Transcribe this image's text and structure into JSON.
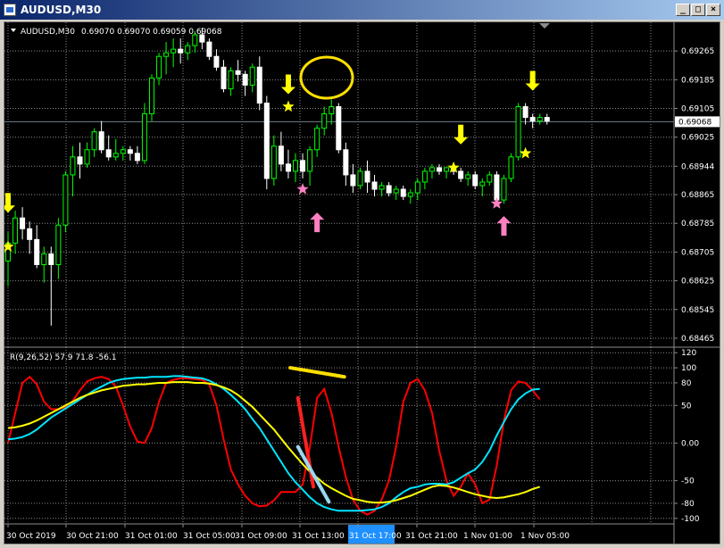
{
  "window": {
    "title": "AUDUSD,M30",
    "buttons": [
      "_",
      "□",
      "×"
    ]
  },
  "chart_header": {
    "symbol": "AUDUSD,M30",
    "ohlc": "0.69070 0.69070 0.69059 0.69068"
  },
  "indicator_label": "R(9,26,52) 57.9 71.8 -56.1",
  "current_price": "0.69068",
  "colors": {
    "bull_candle": "#00ff00",
    "bear_candle": "#ffffff",
    "grid": "#8c8c8c",
    "fast_line": "#ff0000",
    "medium_line": "#00e5ff",
    "slow_line": "#ffff00",
    "sell_arrow": "#ffff00",
    "buy_arrow": "#ff80c0",
    "annotation_yellow": "#ffe000",
    "time_highlight": "#1e90ff"
  },
  "chart_data": [
    {
      "type": "candlestick",
      "title": "AUDUSD,M30",
      "ylim": [
        0.68445,
        0.69335
      ],
      "y_ticks": [
        "0.69265",
        "0.69185",
        "0.69105",
        "0.69025",
        "0.68944",
        "0.68865",
        "0.68785",
        "0.68705",
        "0.68625",
        "0.68545",
        "0.68465"
      ],
      "y_tick_values": [
        0.69265,
        0.69185,
        0.69105,
        0.69025,
        0.68944,
        0.68865,
        0.68785,
        0.68705,
        0.68625,
        0.68545,
        0.68465
      ],
      "x_ticks": [
        "30 Oct 2019",
        "30 Oct 21:00",
        "31 Oct 01:00",
        "31 Oct 05:00",
        "31 Oct 09:00",
        "31 Oct 13:00",
        "31 Oct 17:00",
        "31 Oct 21:00",
        "1 Nov 01:00",
        "1 Nov 05:00"
      ],
      "candles": [
        [
          0.6868,
          0.6876,
          0.6861,
          0.6873
        ],
        [
          0.6873,
          0.6882,
          0.687,
          0.688
        ],
        [
          0.688,
          0.6883,
          0.6874,
          0.6877
        ],
        [
          0.6877,
          0.6879,
          0.687,
          0.6874
        ],
        [
          0.6874,
          0.6878,
          0.6866,
          0.6867
        ],
        [
          0.6867,
          0.6872,
          0.6862,
          0.687
        ],
        [
          0.687,
          0.6872,
          0.685,
          0.6867
        ],
        [
          0.6867,
          0.688,
          0.6863,
          0.6878
        ],
        [
          0.6878,
          0.6893,
          0.6876,
          0.6892
        ],
        [
          0.6892,
          0.69,
          0.6886,
          0.6897
        ],
        [
          0.6897,
          0.6901,
          0.6891,
          0.6895
        ],
        [
          0.6895,
          0.6901,
          0.6894,
          0.6899
        ],
        [
          0.6899,
          0.6905,
          0.6897,
          0.6904
        ],
        [
          0.6904,
          0.6907,
          0.6898,
          0.6899
        ],
        [
          0.6899,
          0.6903,
          0.6896,
          0.6897
        ],
        [
          0.6897,
          0.6902,
          0.6896,
          0.6898
        ],
        [
          0.6898,
          0.69,
          0.6896,
          0.6899
        ],
        [
          0.6899,
          0.69,
          0.6896,
          0.6898
        ],
        [
          0.6898,
          0.69,
          0.6895,
          0.6896
        ],
        [
          0.6896,
          0.6912,
          0.6895,
          0.6909
        ],
        [
          0.6909,
          0.692,
          0.6907,
          0.6919
        ],
        [
          0.6919,
          0.6926,
          0.6917,
          0.6925
        ],
        [
          0.6925,
          0.6929,
          0.692,
          0.6926
        ],
        [
          0.6926,
          0.693,
          0.6922,
          0.6927
        ],
        [
          0.6927,
          0.693,
          0.6923,
          0.6926
        ],
        [
          0.6926,
          0.6929,
          0.6924,
          0.6928
        ],
        [
          0.6928,
          0.6932,
          0.6926,
          0.6931
        ],
        [
          0.6931,
          0.6933,
          0.6927,
          0.6929
        ],
        [
          0.6929,
          0.693,
          0.6924,
          0.6925
        ],
        [
          0.6925,
          0.6927,
          0.6921,
          0.6922
        ],
        [
          0.6922,
          0.6924,
          0.6915,
          0.6916
        ],
        [
          0.6916,
          0.6922,
          0.6914,
          0.6921
        ],
        [
          0.6921,
          0.6924,
          0.6918,
          0.692
        ],
        [
          0.692,
          0.6921,
          0.6914,
          0.6917
        ],
        [
          0.6917,
          0.6923,
          0.6915,
          0.6922
        ],
        [
          0.6922,
          0.6925,
          0.691,
          0.6912
        ],
        [
          0.6912,
          0.6914,
          0.6888,
          0.6891
        ],
        [
          0.6891,
          0.6903,
          0.6889,
          0.69
        ],
        [
          0.69,
          0.6904,
          0.6893,
          0.6895
        ],
        [
          0.6895,
          0.6899,
          0.6891,
          0.6893
        ],
        [
          0.6893,
          0.6898,
          0.689,
          0.6896
        ],
        [
          0.6896,
          0.6898,
          0.6891,
          0.6893
        ],
        [
          0.6893,
          0.69,
          0.6889,
          0.6899
        ],
        [
          0.6899,
          0.6906,
          0.6897,
          0.6905
        ],
        [
          0.6905,
          0.6911,
          0.6903,
          0.6909
        ],
        [
          0.6909,
          0.6913,
          0.6906,
          0.6911
        ],
        [
          0.6911,
          0.6912,
          0.6898,
          0.6899
        ],
        [
          0.6899,
          0.6901,
          0.6889,
          0.6892
        ],
        [
          0.6892,
          0.6895,
          0.6887,
          0.6889
        ],
        [
          0.6889,
          0.6894,
          0.6888,
          0.6893
        ],
        [
          0.6893,
          0.6896,
          0.6887,
          0.689
        ],
        [
          0.689,
          0.6892,
          0.6886,
          0.6888
        ],
        [
          0.6888,
          0.689,
          0.6886,
          0.6889
        ],
        [
          0.6889,
          0.689,
          0.6886,
          0.6887
        ],
        [
          0.6887,
          0.6889,
          0.6885,
          0.6888
        ],
        [
          0.6888,
          0.6889,
          0.6885,
          0.6886
        ],
        [
          0.6886,
          0.6888,
          0.6884,
          0.6887
        ],
        [
          0.6887,
          0.6891,
          0.6885,
          0.689
        ],
        [
          0.689,
          0.6894,
          0.6888,
          0.6893
        ],
        [
          0.6893,
          0.6895,
          0.6891,
          0.6894
        ],
        [
          0.6894,
          0.6895,
          0.6892,
          0.6893
        ],
        [
          0.6893,
          0.6894,
          0.6891,
          0.6894
        ],
        [
          0.6894,
          0.6895,
          0.6892,
          0.6893
        ],
        [
          0.6893,
          0.6894,
          0.689,
          0.6891
        ],
        [
          0.6891,
          0.6893,
          0.6889,
          0.6892
        ],
        [
          0.6892,
          0.6893,
          0.6888,
          0.6889
        ],
        [
          0.6889,
          0.6891,
          0.6886,
          0.689
        ],
        [
          0.689,
          0.6893,
          0.6889,
          0.6892
        ],
        [
          0.6892,
          0.6893,
          0.6884,
          0.6885
        ],
        [
          0.6885,
          0.6892,
          0.6884,
          0.6891
        ],
        [
          0.6891,
          0.6898,
          0.689,
          0.6897
        ],
        [
          0.6897,
          0.6912,
          0.6896,
          0.6911
        ],
        [
          0.6911,
          0.6912,
          0.6906,
          0.6908
        ],
        [
          0.6908,
          0.6909,
          0.6905,
          0.6907
        ],
        [
          0.6907,
          0.6909,
          0.6906,
          0.6908
        ],
        [
          0.6908,
          0.6909,
          0.6906,
          0.6907
        ]
      ],
      "current_price": 0.69068,
      "signals": [
        {
          "type": "sell",
          "index": 0,
          "price": 0.688
        },
        {
          "type": "sell",
          "index": 39,
          "price": 0.6913
        },
        {
          "type": "sell",
          "index": 63,
          "price": 0.6899
        },
        {
          "type": "sell",
          "index": 73,
          "price": 0.6914
        },
        {
          "type": "buy",
          "index": 43,
          "price": 0.6883
        },
        {
          "type": "buy",
          "index": 69,
          "price": 0.6882
        }
      ],
      "stars": [
        {
          "color": "yellow",
          "index": 0,
          "price": 0.6872
        },
        {
          "color": "yellow",
          "index": 39,
          "price": 0.6911
        },
        {
          "color": "pink",
          "index": 41,
          "price": 0.6888
        },
        {
          "color": "yellow",
          "index": 62,
          "price": 0.6894
        },
        {
          "color": "pink",
          "index": 68,
          "price": 0.6884
        },
        {
          "color": "yellow",
          "index": 72,
          "price": 0.6898
        }
      ]
    },
    {
      "type": "line",
      "title": "R(9,26,52) 57.9 71.8 -56.1",
      "ylim": [
        -105,
        125
      ],
      "y_ticks": [
        "120",
        "100",
        "80",
        "50",
        "0.00",
        "-50",
        "-80",
        "-100"
      ],
      "y_tick_values": [
        120,
        100,
        80,
        50,
        0,
        -50,
        -80,
        -100
      ],
      "series": [
        {
          "name": "9",
          "color": "#ff0000",
          "values": [
            0,
            40,
            80,
            88,
            78,
            55,
            45,
            45,
            48,
            56,
            70,
            82,
            86,
            88,
            85,
            75,
            50,
            22,
            2,
            0,
            20,
            55,
            80,
            84,
            86,
            86,
            85,
            84,
            78,
            50,
            5,
            -35,
            -55,
            -70,
            -80,
            -84,
            -83,
            -76,
            -65,
            -65,
            -65,
            -55,
            -5,
            60,
            72,
            40,
            -5,
            -45,
            -75,
            -90,
            -95,
            -90,
            -75,
            -50,
            -5,
            55,
            80,
            85,
            70,
            40,
            -10,
            -50,
            -70,
            -58,
            -40,
            -55,
            -80,
            -75,
            -30,
            30,
            70,
            82,
            80,
            70,
            58
          ]
        },
        {
          "name": "26",
          "color": "#00e5ff",
          "values": [
            5,
            6,
            8,
            12,
            18,
            26,
            34,
            40,
            46,
            52,
            58,
            64,
            70,
            75,
            80,
            83,
            85,
            86,
            87,
            87,
            88,
            88,
            88,
            89,
            89,
            88,
            87,
            86,
            83,
            78,
            72,
            64,
            55,
            45,
            32,
            20,
            5,
            -10,
            -25,
            -40,
            -52,
            -62,
            -72,
            -80,
            -85,
            -88,
            -90,
            -90,
            -90,
            -90,
            -89,
            -88,
            -85,
            -80,
            -72,
            -65,
            -60,
            -58,
            -55,
            -54,
            -54,
            -55,
            -52,
            -46,
            -40,
            -35,
            -25,
            -10,
            10,
            28,
            45,
            58,
            66,
            71,
            72
          ]
        },
        {
          "name": "52",
          "color": "#ffff00",
          "values": [
            20,
            21,
            23,
            26,
            30,
            35,
            40,
            45,
            50,
            55,
            60,
            64,
            67,
            70,
            72,
            74,
            76,
            77,
            78,
            78,
            79,
            80,
            80,
            81,
            81,
            81,
            80,
            80,
            79,
            77,
            74,
            70,
            64,
            56,
            48,
            38,
            28,
            18,
            6,
            -6,
            -17,
            -28,
            -38,
            -46,
            -54,
            -60,
            -65,
            -70,
            -74,
            -76,
            -78,
            -79,
            -79,
            -78,
            -76,
            -73,
            -70,
            -66,
            -62,
            -58,
            -56,
            -57,
            -59,
            -62,
            -65,
            -68,
            -70,
            -72,
            -73,
            -72,
            -70,
            -68,
            -65,
            -61,
            -58
          ]
        }
      ],
      "annotations": [
        {
          "type": "segment",
          "color": "yellow",
          "from": [
            73,
            100
          ],
          "to": [
            87,
            88
          ]
        },
        {
          "type": "segment",
          "color": "red",
          "from": [
            75,
            60
          ],
          "to": [
            79,
            -58
          ]
        },
        {
          "type": "segment",
          "color": "lightblue",
          "from": [
            75,
            -5
          ],
          "to": [
            83,
            -78
          ]
        }
      ]
    }
  ]
}
